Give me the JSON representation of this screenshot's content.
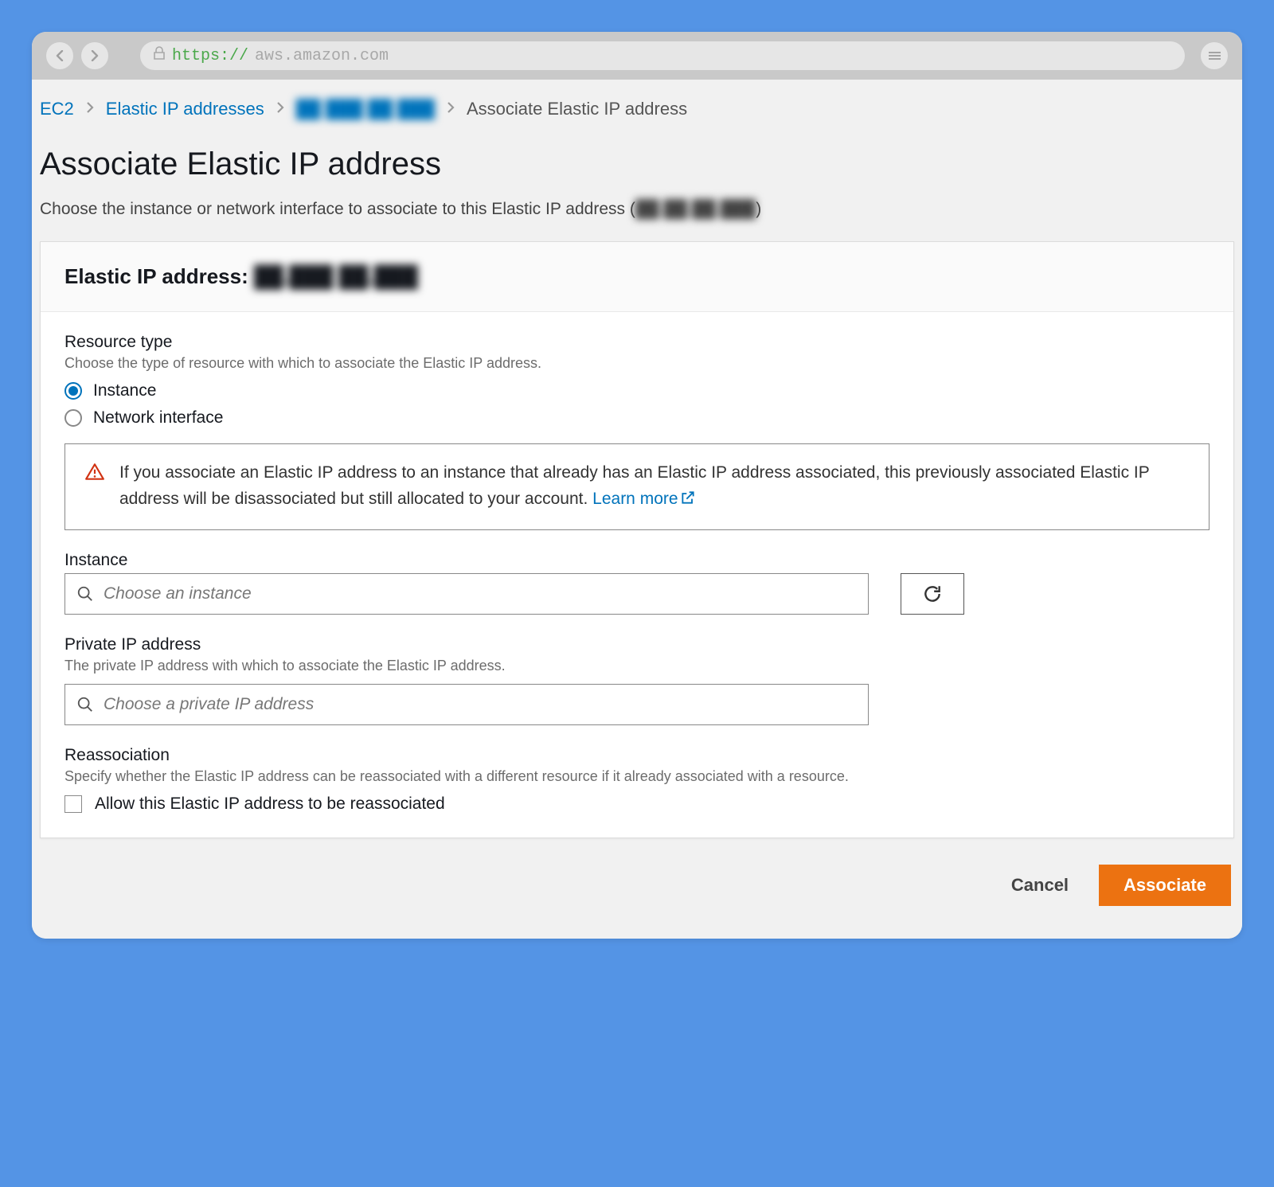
{
  "browser": {
    "url_scheme": "https://",
    "url_rest": "aws.amazon.com"
  },
  "breadcrumb": {
    "ec2": "EC2",
    "eip_list": "Elastic IP addresses",
    "eip_id": "██ ███ ██ ███",
    "current": "Associate Elastic IP address"
  },
  "page_title": "Associate Elastic IP address",
  "page_desc_prefix": "Choose the instance or network interface to associate to this Elastic IP address (",
  "page_desc_ip": "██.██.██.███",
  "page_desc_suffix": ")",
  "card": {
    "header_prefix": "Elastic IP address: ",
    "header_ip": "██.███ ██.███"
  },
  "resource_type": {
    "label": "Resource type",
    "help": "Choose the type of resource with which to associate the Elastic IP address.",
    "option_instance": "Instance",
    "option_eni": "Network interface"
  },
  "alert": {
    "text": "If you associate an Elastic IP address to an instance that already has an Elastic IP address associated, this previously associated Elastic IP address will be disassociated but still allocated to your account. ",
    "link": "Learn more"
  },
  "instance": {
    "label": "Instance",
    "placeholder": "Choose an instance"
  },
  "private_ip": {
    "label": "Private IP address",
    "help": "The private IP address with which to associate the Elastic IP address.",
    "placeholder": "Choose a private IP address"
  },
  "reassoc": {
    "label": "Reassociation",
    "help": "Specify whether the Elastic IP address can be reassociated with a different resource if it already associated with a resource.",
    "checkbox": "Allow this Elastic IP address to be reassociated"
  },
  "actions": {
    "cancel": "Cancel",
    "associate": "Associate"
  }
}
